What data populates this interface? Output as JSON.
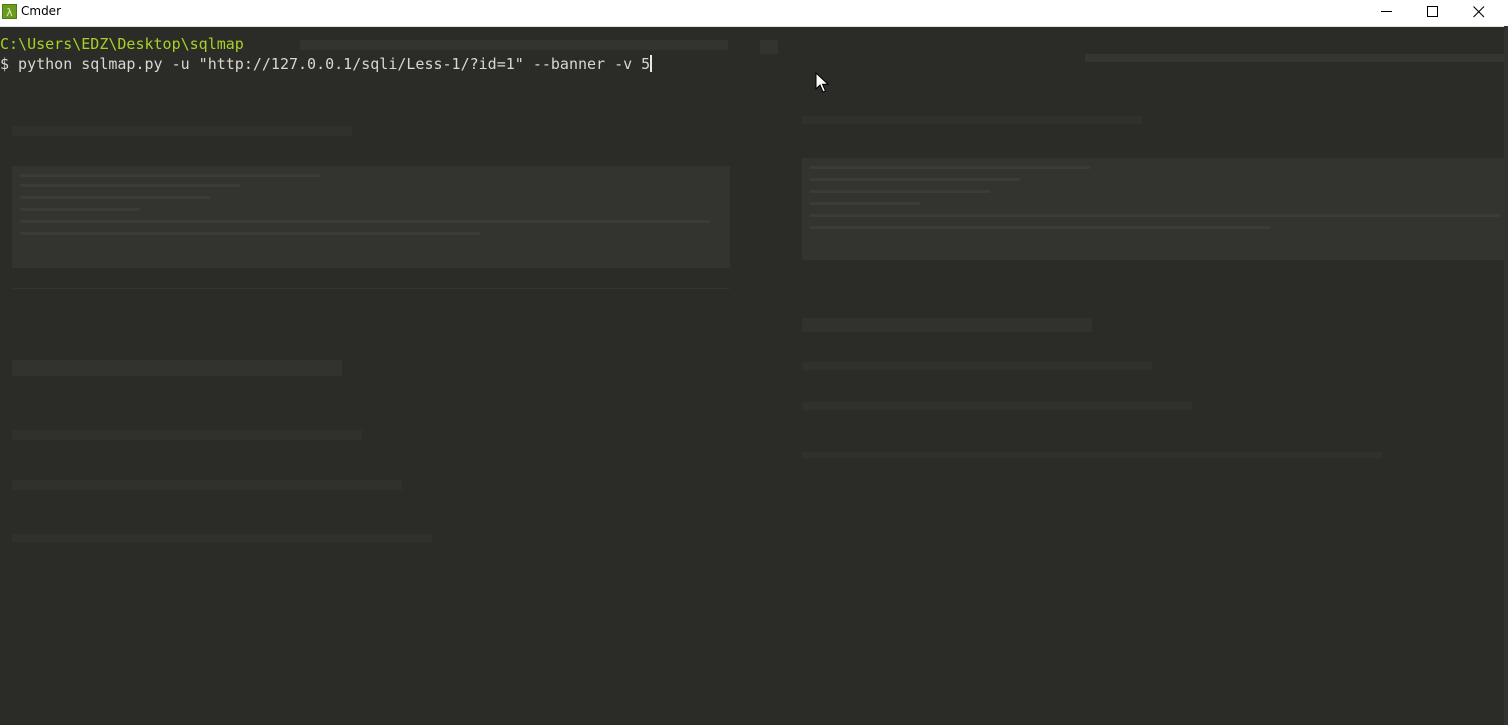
{
  "window": {
    "title": "Cmder",
    "app_icon_glyph": "λ",
    "controls": [
      "minimize-icon",
      "maximize-icon",
      "close-icon"
    ]
  },
  "terminal": {
    "cwd": "C:\\Users\\EDZ\\Desktop\\sqlmap",
    "prompt_symbol": "$",
    "command": " python sqlmap.py -u \"http://127.0.0.1/sqli/Less-1/?id=1\" --banner -v 5"
  },
  "colors": {
    "terminal_bg": "#2b2c28",
    "cwd_green": "#a6d126",
    "text": "#d8d8d0",
    "icon_green": "#6a9a1f"
  }
}
